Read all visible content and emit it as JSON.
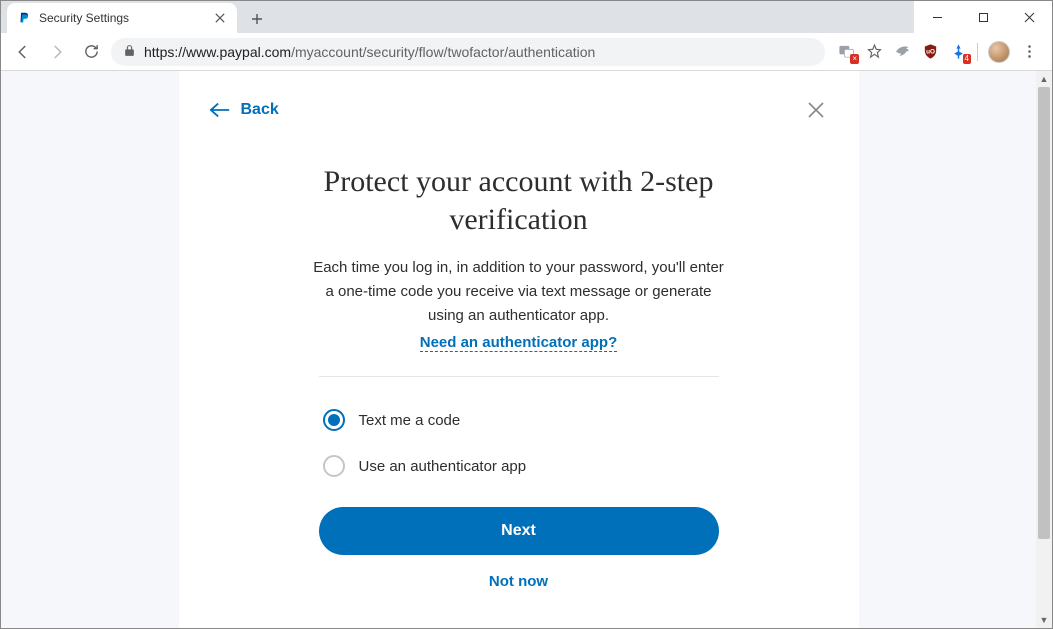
{
  "window": {
    "tab_title": "Security Settings",
    "url_host": "https://www.paypal.com",
    "url_path": "/myaccount/security/flow/twofactor/authentication",
    "ext_badge": "4"
  },
  "dialog": {
    "back_label": "Back",
    "heading": "Protect your account with 2-step verification",
    "description": "Each time you log in, in addition to your password, you'll enter a one-time code you receive via text message or generate using an authenticator app.",
    "auth_app_link": "Need an authenticator app?",
    "options": [
      {
        "label": "Text me a code",
        "selected": true
      },
      {
        "label": "Use an authenticator app",
        "selected": false
      }
    ],
    "next_label": "Next",
    "not_now_label": "Not now"
  }
}
